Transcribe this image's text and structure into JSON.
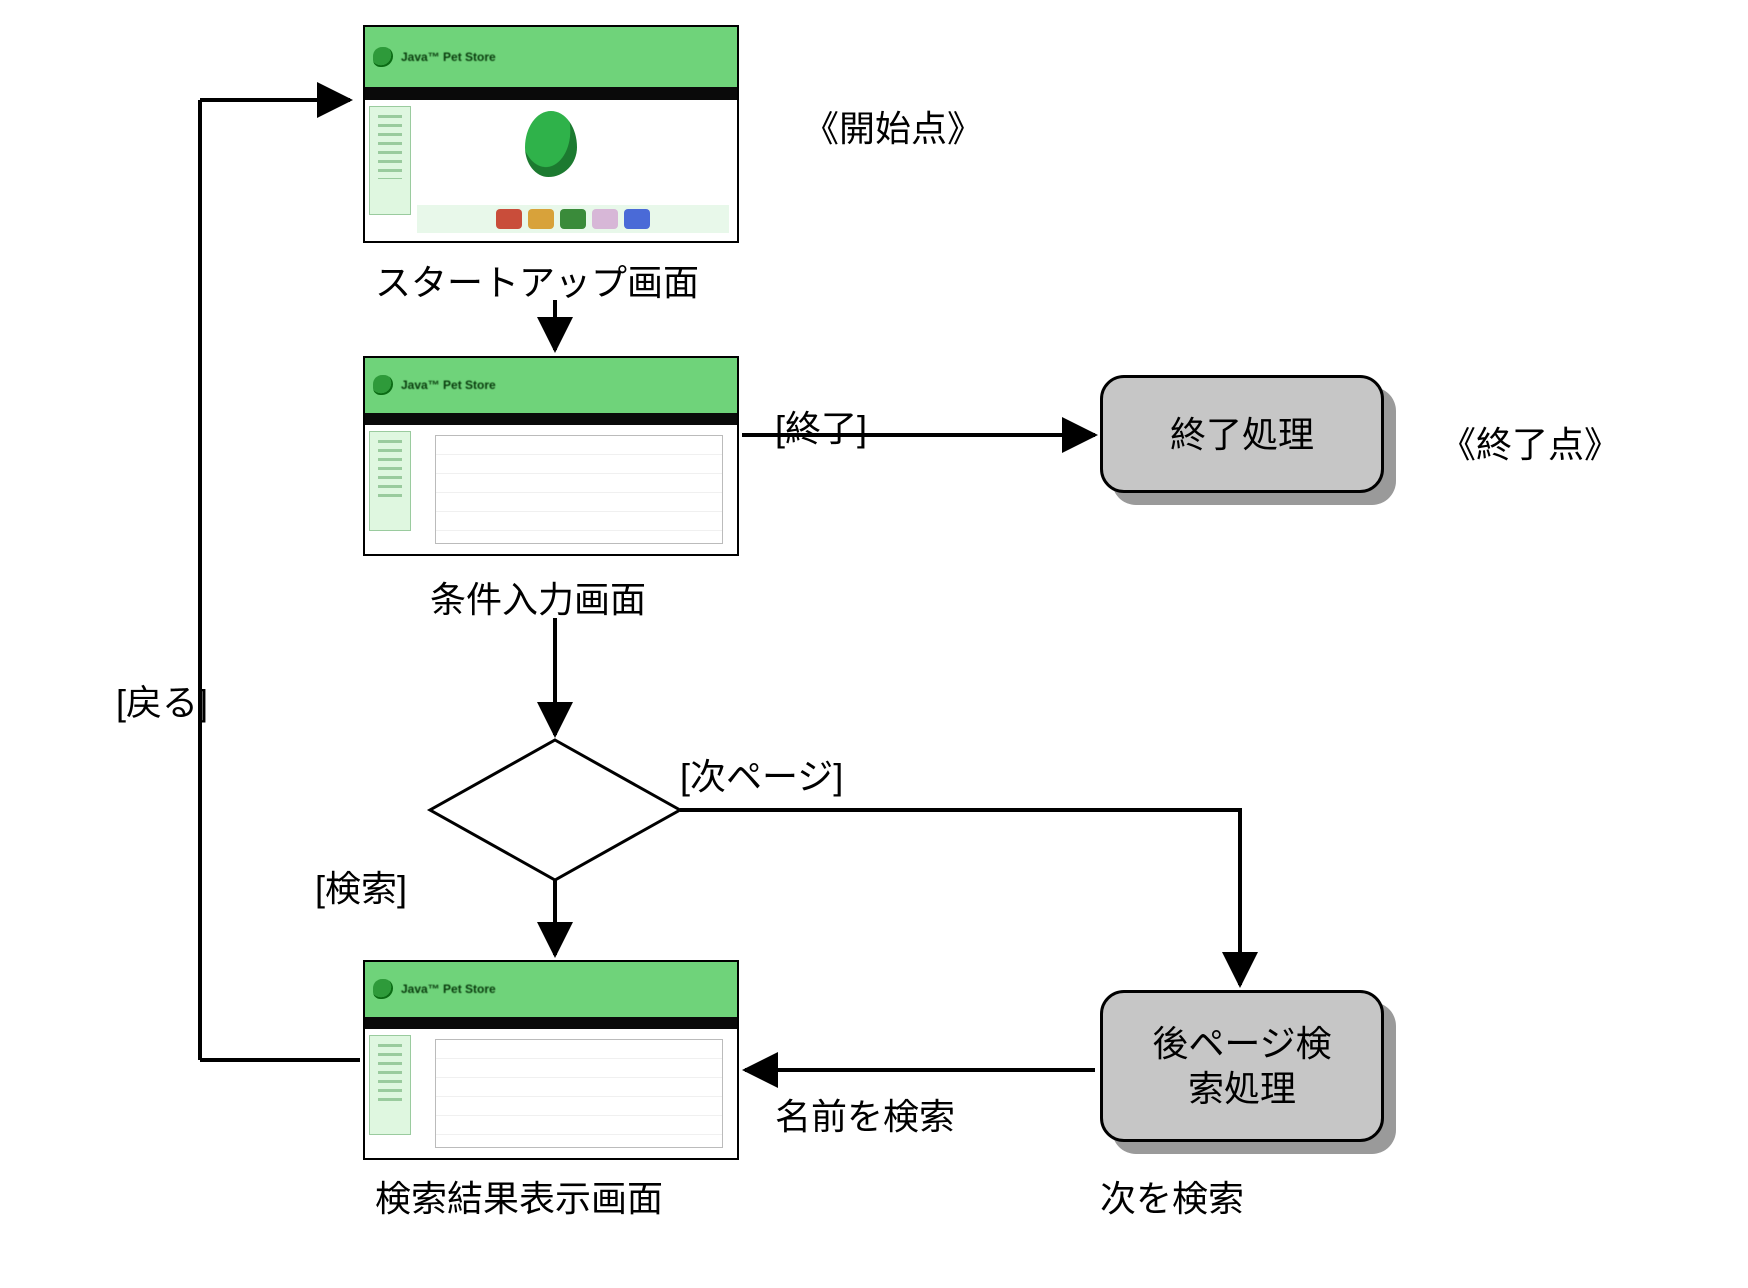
{
  "annotations": {
    "start_point": "《開始点》",
    "end_point": "《終了点》"
  },
  "edge_labels": {
    "back": "[戻る]",
    "exit": "[終了]",
    "next_page": "[次ページ]",
    "search": "[検索]",
    "search_name": "名前を検索",
    "search_next": "次を検索"
  },
  "nodes": {
    "startup_screen": {
      "caption": "スタートアップ画面",
      "header_title": "Java™ Pet Store"
    },
    "condition_screen": {
      "caption": "条件入力画面",
      "header_title": "Java™ Pet Store"
    },
    "result_screen": {
      "caption": "検索結果表示画面",
      "header_title": "Java™ Pet Store"
    },
    "exit_process": {
      "label": "終了処理"
    },
    "next_page_process": {
      "label": "後ページ検\n索処理"
    }
  }
}
